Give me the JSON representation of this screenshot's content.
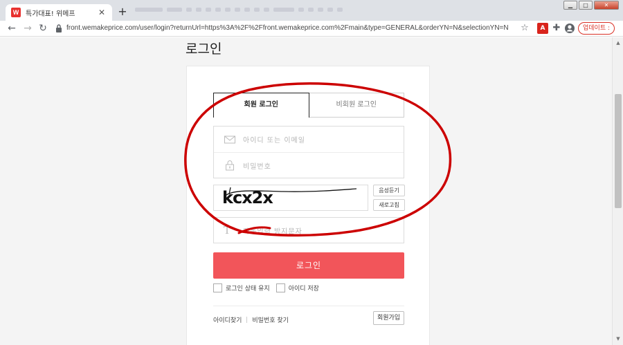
{
  "browser": {
    "tab_title": "특가대표! 위메프",
    "favicon_letter": "W",
    "new_tab": "+",
    "url": "front.wemakeprice.com/user/login?returnUrl=https%3A%2F%2Ffront.wemakeprice.com%2Fmain&type=GENERAL&orderYN=N&selectionYN=N",
    "update_label": "업데이트 :",
    "pdf_label": "A"
  },
  "page": {
    "title": "로그인",
    "tabs": [
      {
        "label": "회원 로그인",
        "active": true
      },
      {
        "label": "비회원 로그인",
        "active": false
      }
    ],
    "id_placeholder": "아이디 또는 이메일",
    "password_placeholder": "비밀번호",
    "captcha_text": "kcx2x",
    "captcha_audio_label": "음성듣기",
    "captcha_refresh_label": "새로고침",
    "captcha_input_placeholder": "자동입력 방지문자",
    "login_button": "로그인",
    "keep_login_label": "로그인 상태 유지",
    "save_id_label": "아이디 저장",
    "find_id_label": "아이디찾기",
    "find_password_label": "비밀번호 찾기",
    "signup_label": "회원가입"
  },
  "colors": {
    "brand_red": "#f2555a",
    "annotation_red": "#cc0000"
  }
}
